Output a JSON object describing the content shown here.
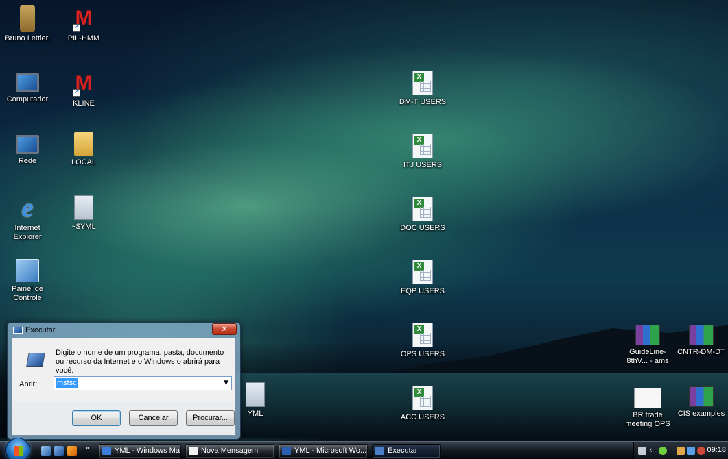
{
  "desktop": {
    "left_column": [
      {
        "label": "Bruno Lettieri",
        "icon": "user-folder-icon"
      },
      {
        "label": "Computador",
        "icon": "computer-icon"
      },
      {
        "label": "Rede",
        "icon": "network-icon"
      },
      {
        "label": "Internet Explorer",
        "icon": "internet-explorer-icon"
      },
      {
        "label": "Painel de Controle",
        "icon": "control-panel-icon"
      }
    ],
    "second_column": [
      {
        "label": "PIL-HMM",
        "icon": "m-shortcut-icon"
      },
      {
        "label": "KLINE",
        "icon": "m-shortcut-icon"
      },
      {
        "label": "LOCAL",
        "icon": "folder-icon"
      },
      {
        "label": "~$YML",
        "icon": "document-icon"
      }
    ],
    "center_column": [
      {
        "label": "DM-T USERS",
        "icon": "excel-file-icon"
      },
      {
        "label": "ITJ USERS",
        "icon": "excel-file-icon"
      },
      {
        "label": "DOC USERS",
        "icon": "excel-file-icon"
      },
      {
        "label": "EQP USERS",
        "icon": "excel-file-icon"
      },
      {
        "label": "OPS USERS",
        "icon": "excel-file-icon"
      },
      {
        "label": "ACC USERS",
        "icon": "excel-file-icon"
      }
    ],
    "yml_icon": {
      "label": "YML",
      "icon": "word-document-icon"
    },
    "right_icons": [
      {
        "label": "GuideLine-8thV... - ams",
        "icon": "rar-archive-icon"
      },
      {
        "label": "CNTR-DM-DT",
        "icon": "rar-archive-icon"
      },
      {
        "label": "BR trade meeting OPS",
        "icon": "document-thumbnail-icon"
      },
      {
        "label": "CIS examples",
        "icon": "rar-archive-icon"
      }
    ]
  },
  "run_dialog": {
    "title": "Executar",
    "close_symbol": "✕",
    "description": "Digite o nome de um programa, pasta, documento ou recurso da Internet e o Windows o abrirá para você.",
    "open_label": "Abrir:",
    "input_value": "mstsc",
    "ok_label": "OK",
    "cancel_label": "Cancelar",
    "browse_label": "Procurar..."
  },
  "taskbar": {
    "chevron": "»",
    "buttons": [
      {
        "label": "YML - Windows Mail",
        "color": "#3b7dd8"
      },
      {
        "label": "Nova Mensagem",
        "color": "#f2f2f2"
      },
      {
        "label": "YML - Microsoft Wo...",
        "color": "#2b5fb4"
      },
      {
        "label": "Executar",
        "color": "#4a7fc8"
      }
    ],
    "tray_chevron": "‹",
    "clock": "09:18"
  }
}
